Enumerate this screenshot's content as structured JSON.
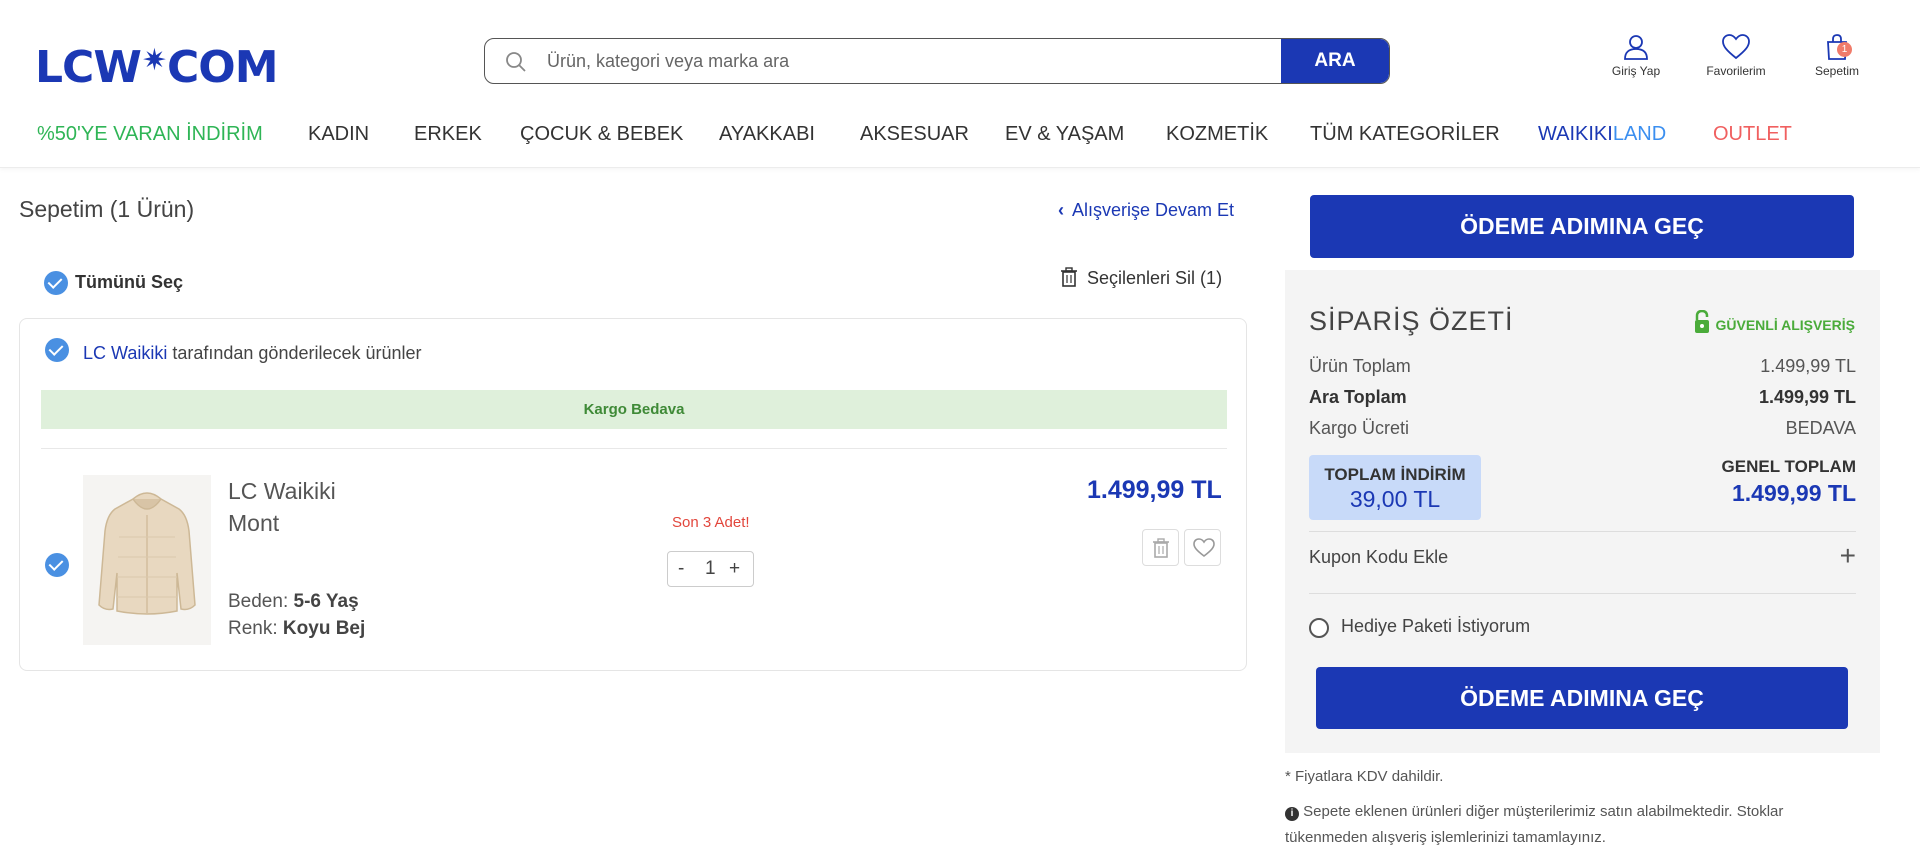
{
  "header": {
    "logo": "LCW COM",
    "search_placeholder": "Ürün, kategori veya marka ara",
    "search_button": "ARA",
    "login": "Giriş Yap",
    "favorites": "Favorilerim",
    "cart": "Sepetim",
    "cart_count": "1"
  },
  "nav": [
    {
      "label": "%50'YE VARAN İNDİRİM",
      "color": "#2fb556"
    },
    {
      "label": "KADIN"
    },
    {
      "label": "ERKEK"
    },
    {
      "label": "ÇOCUK & BEBEK"
    },
    {
      "label": "AYAKKABI"
    },
    {
      "label": "AKSESUAR"
    },
    {
      "label": "EV & YAŞAM"
    },
    {
      "label": "KOZMETİK"
    },
    {
      "label": "TÜM KATEGORİLER"
    },
    {
      "label_part1": "WAIKIKI",
      "label_part2": "LAND",
      "colors": [
        "#1b38b4",
        "#3b8ff0"
      ]
    },
    {
      "label": "OUTLET",
      "color": "#f06060"
    }
  ],
  "cart": {
    "title": "Sepetim (1 Ürün)",
    "continue": "Alışverişe Devam Et",
    "select_all": "Tümünü Seç",
    "delete_selected": "Seçilenleri Sil (1)",
    "seller_name": "LC Waikiki",
    "seller_suffix": "tarafından gönderilecek ürünler",
    "shipping_banner": "Kargo Bedava",
    "item": {
      "brand": "LC Waikiki",
      "name": "Mont",
      "stock_warning": "Son 3 Adet!",
      "quantity": "1",
      "minus": "-",
      "plus": "+",
      "price": "1.499,99 TL",
      "size_label": "Beden:",
      "size": "5-6 Yaş",
      "color_label": "Renk:",
      "color": "Koyu Bej"
    }
  },
  "summary": {
    "checkout_button": "ÖDEME ADIMINA GEÇ",
    "title": "SİPARİŞ ÖZETİ",
    "secure": "GÜVENLİ ALIŞVERİŞ",
    "product_total_label": "Ürün Toplam",
    "product_total": "1.499,99 TL",
    "subtotal_label": "Ara Toplam",
    "subtotal": "1.499,99 TL",
    "shipping_label": "Kargo Ücreti",
    "shipping": "BEDAVA",
    "discount_label": "TOPLAM İNDİRİM",
    "discount": "39,00 TL",
    "grand_total_label": "GENEL TOPLAM",
    "grand_total": "1.499,99 TL",
    "coupon": "Kupon Kodu Ekle",
    "gift": "Hediye Paketi İstiyorum",
    "vat_note": "* Fiyatlara KDV dahildir.",
    "stock_note_line1": "Sepete eklenen ürünleri diğer müşterilerimiz satın alabilmektedir. Stoklar",
    "stock_note_line2": "tükenmeden alışveriş işlemlerinizi tamamlayınız."
  }
}
